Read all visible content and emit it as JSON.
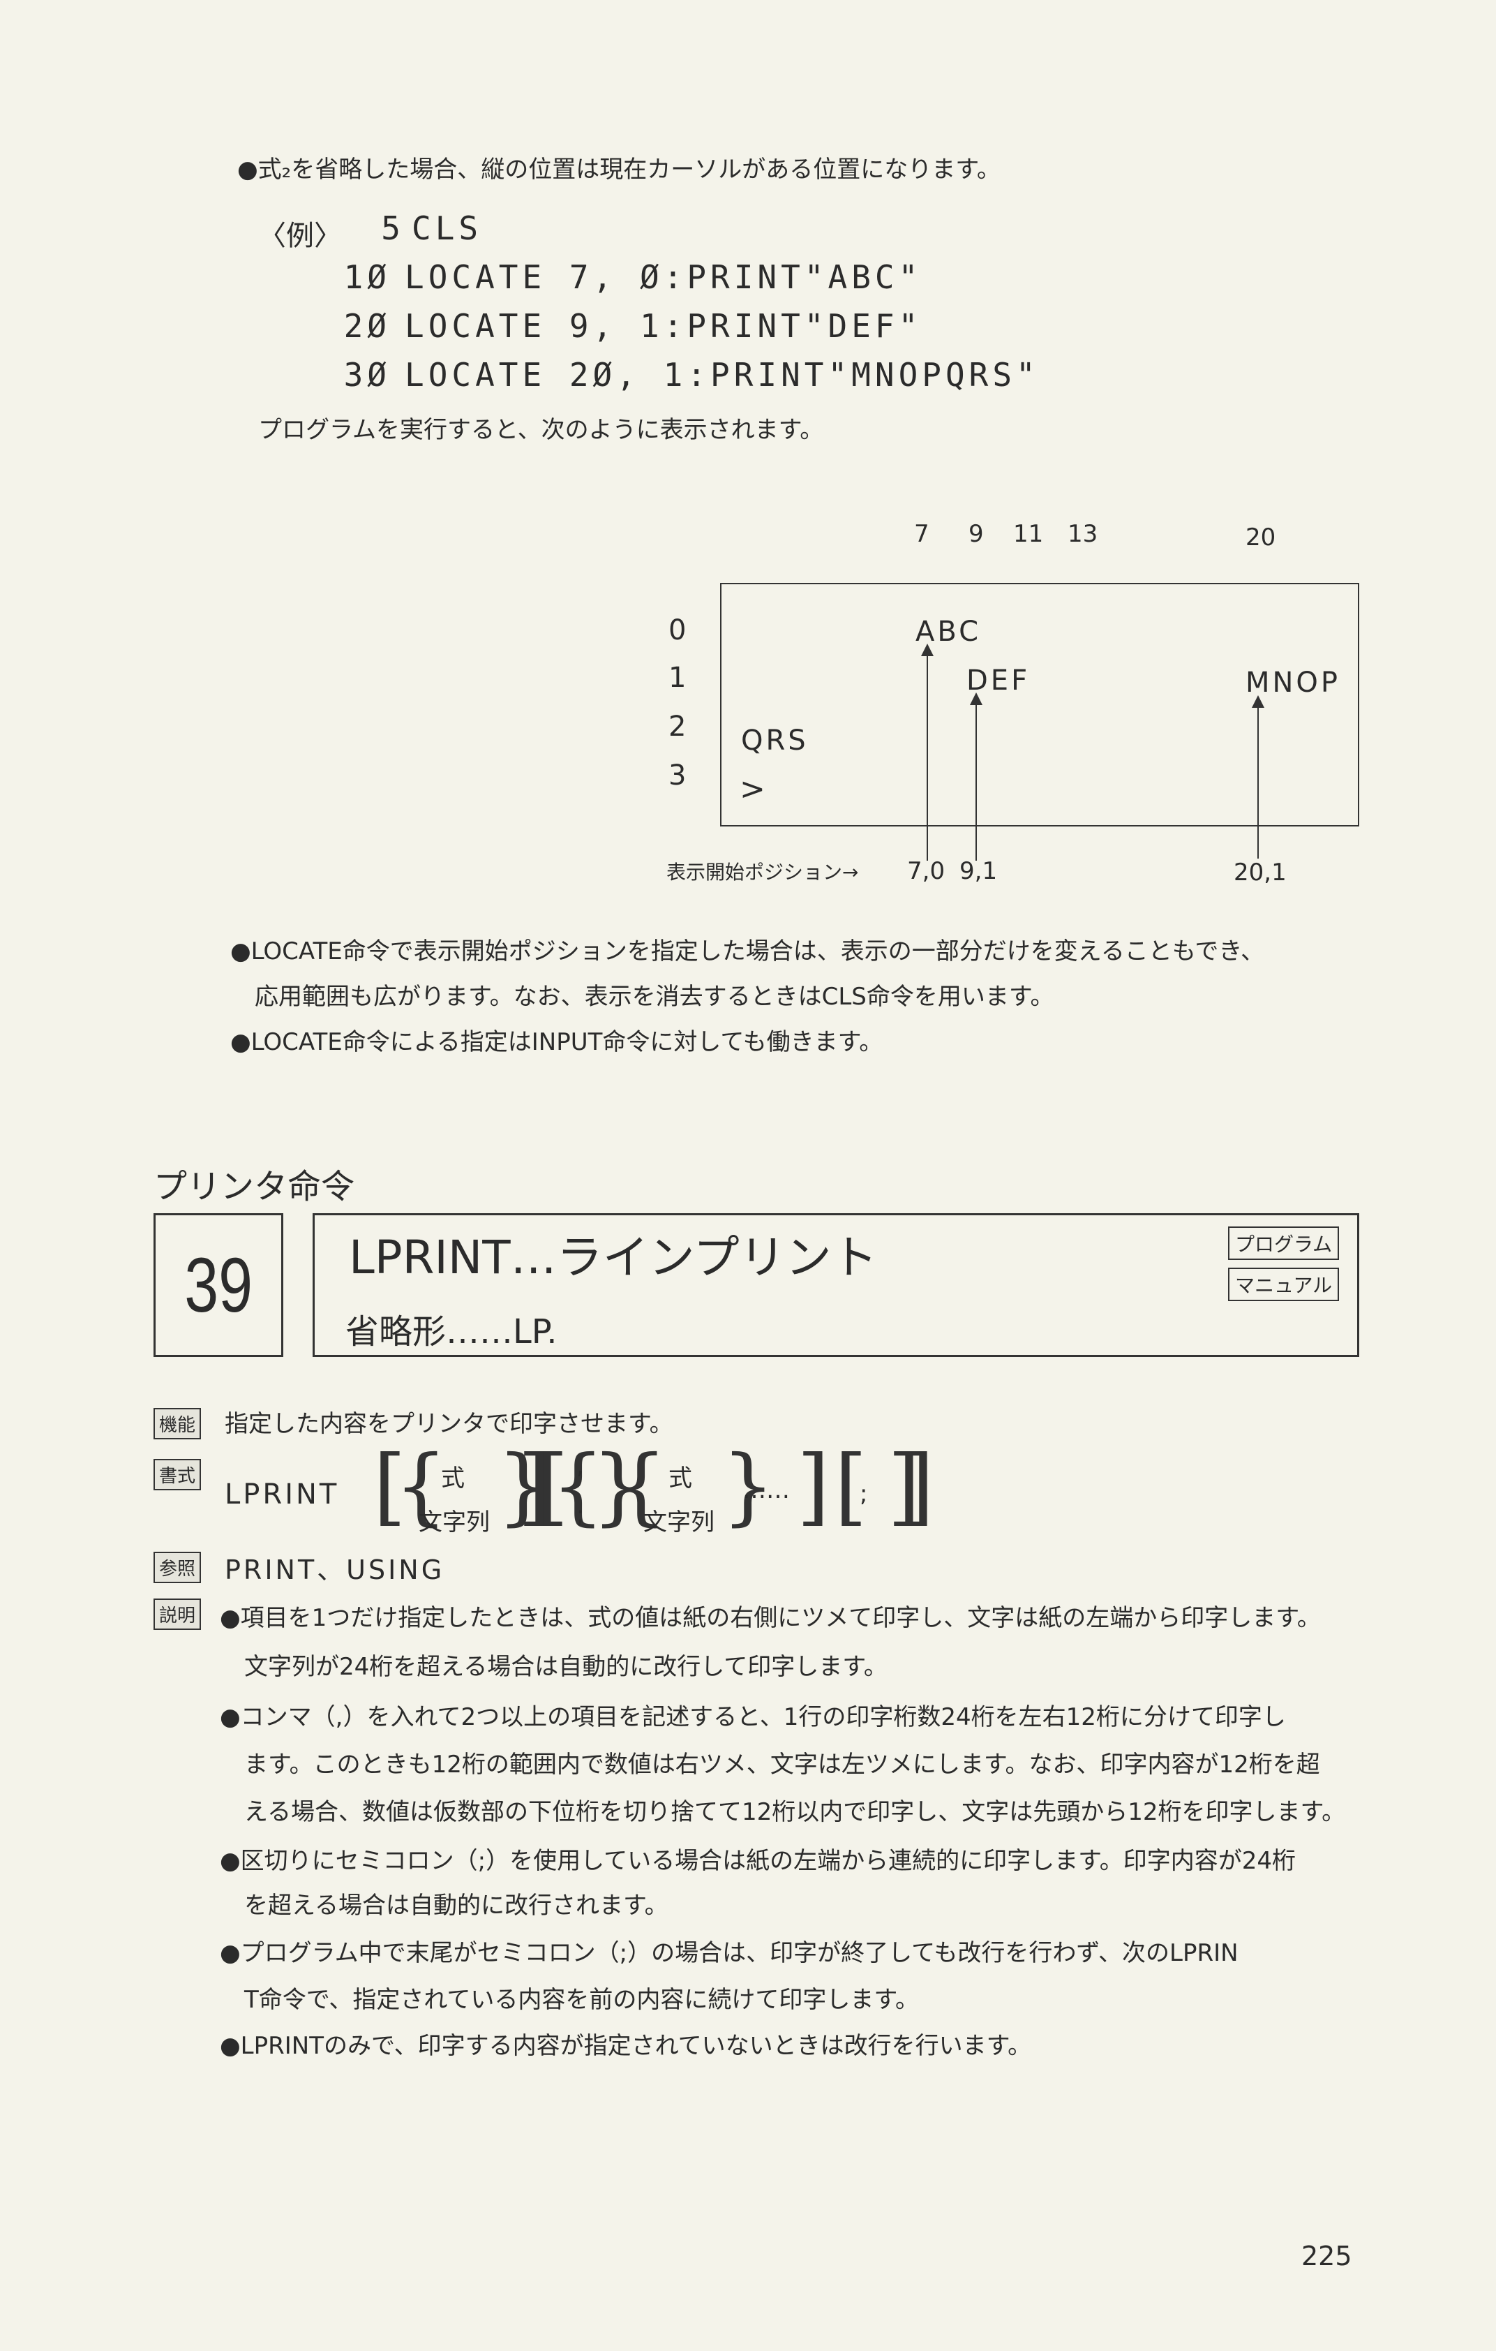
{
  "top": {
    "bullet_note": "●式₂を省略した場合、縦の位置は現在カーソルがある位置になります。",
    "example_label": "〈例〉",
    "code_lines": [
      {
        "num": "5",
        "text": "CLS"
      },
      {
        "num": "1Ø",
        "text": "LOCATE 7, Ø:PRINT\"ABC\""
      },
      {
        "num": "2Ø",
        "text": "LOCATE 9, 1:PRINT\"DEF\""
      },
      {
        "num": "3Ø",
        "text": "LOCATE 2Ø, 1:PRINT\"MNOPQRS\""
      }
    ],
    "result_text": "プログラムを実行すると、次のように表示されます。"
  },
  "diagram": {
    "col_labels": [
      "7",
      "9",
      "11",
      "13",
      "20"
    ],
    "row_labels": [
      "0",
      "1",
      "2",
      "3"
    ],
    "screen_texts": {
      "abc": "ABC",
      "def": "DEF",
      "mnop": "MNOP",
      "qrs": "QRS",
      "prompt": ">"
    },
    "start_label": "表示開始ポジション→",
    "pos_labels": {
      "p1": "7,0",
      "p2": "9,1",
      "p3": "20,1"
    }
  },
  "notes": [
    "●LOCATE命令で表示開始ポジションを指定した場合は、表示の一部分だけを変えることもでき、",
    "応用範囲も広がります。なお、表示を消去するときはCLS命令を用います。",
    "●LOCATE命令による指定はINPUT命令に対しても働きます。"
  ],
  "section": {
    "heading": "プリンタ命令",
    "number": "39",
    "title": "LPRINT…ラインプリント",
    "abbrev": "省略形……LP.",
    "tags": [
      "プログラム",
      "マニュアル"
    ]
  },
  "function": {
    "label": "機能",
    "text": "指定した内容をプリンタで印字させます。"
  },
  "syntax": {
    "label": "書式",
    "keyword": "LPRINT",
    "opt1_top": "式",
    "opt1_bottom": "文字列",
    "sep_top": ",",
    "sep_bottom": ";",
    "opt2_top": "式",
    "opt2_bottom": "文字列",
    "ellipsis": "……",
    "end": ";"
  },
  "reference": {
    "label": "参照",
    "text": "PRINT、USING"
  },
  "explanation": {
    "label": "説明",
    "lines": [
      "●項目を1つだけ指定したときは、式の値は紙の右側にツメて印字し、文字は紙の左端から印字します。",
      "文字列が24桁を超える場合は自動的に改行して印字します。",
      "●コンマ（,）を入れて2つ以上の項目を記述すると、1行の印字桁数24桁を左右12桁に分けて印字し",
      "ます。このときも12桁の範囲内で数値は右ツメ、文字は左ツメにします。なお、印字内容が12桁を超",
      "える場合、数値は仮数部の下位桁を切り捨てて12桁以内で印字し、文字は先頭から12桁を印字します。",
      "●区切りにセミコロン（;）を使用している場合は紙の左端から連続的に印字します。印字内容が24桁",
      "を超える場合は自動的に改行されます。",
      "●プログラム中で末尾がセミコロン（;）の場合は、印字が終了しても改行を行わず、次のLPRIN",
      "T命令で、指定されている内容を前の内容に続けて印字します。",
      "●LPRINTのみで、印字する内容が指定されていないときは改行を行います。"
    ]
  },
  "page_number": "225"
}
